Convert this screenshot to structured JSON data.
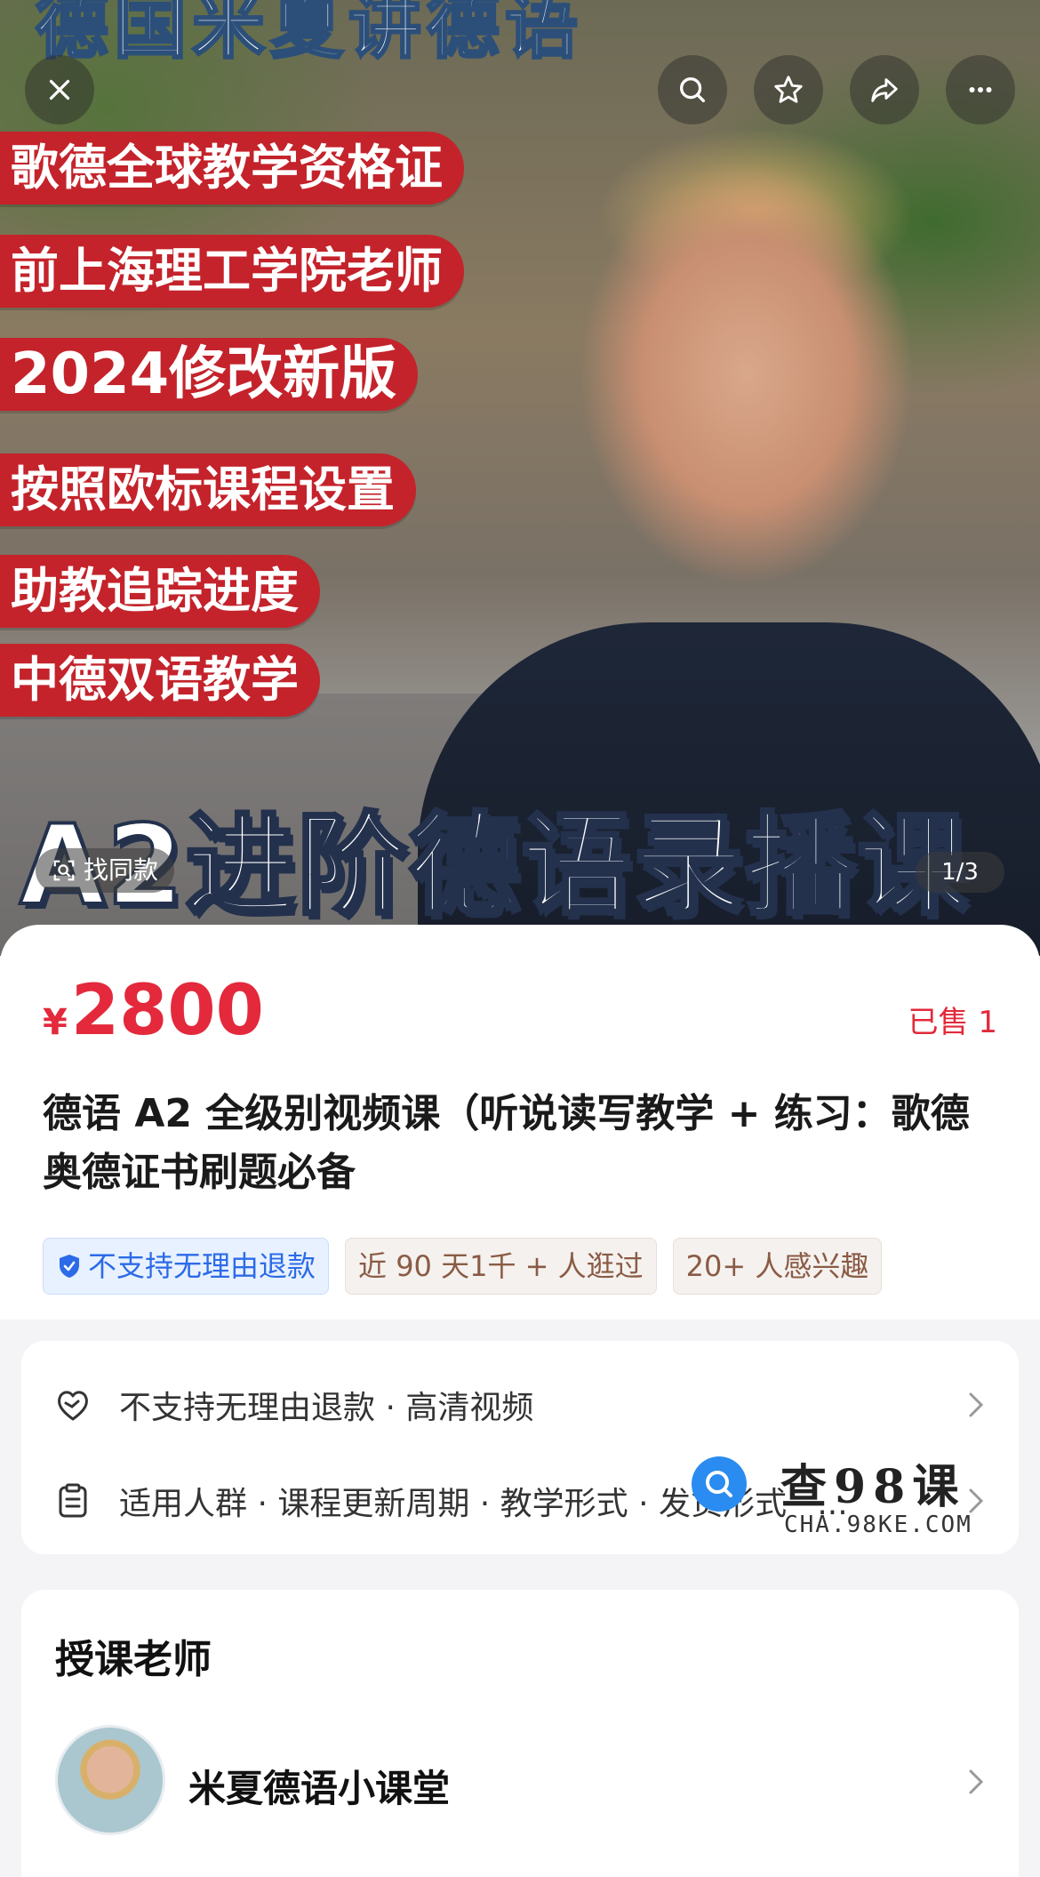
{
  "hero": {
    "top_title": "德国米夏讲德语",
    "tags": [
      "歌德全球教学资格证",
      "前上海理工学院老师",
      "2024修改新版",
      "按照欧标课程设置",
      "助教追踪进度",
      "中德双语教学"
    ],
    "big_title": "A2进阶德语录播课",
    "find_same_label": "找同款",
    "pager": "1/3"
  },
  "toolbar": {
    "icons": [
      "close-icon",
      "search-icon",
      "star-icon",
      "share-icon",
      "more-icon"
    ]
  },
  "product": {
    "currency": "¥",
    "price": "2800",
    "sold": "已售 1",
    "title": "德语 A2 全级别视频课（听说读写教学 + 练习：歌德奥德证书刷题必备",
    "badges": [
      "不支持无理由退款",
      "近 90 天1千 + 人逛过",
      "20+ 人感兴趣"
    ]
  },
  "info": {
    "row1": "不支持无理由退款 · 高清视频",
    "row2": "适用人群 · 课程更新周期 · 教学形式 · 发货形式 · ..."
  },
  "watermark": {
    "text": "查98课",
    "url": "CHA.98KE.COM"
  },
  "teacher": {
    "heading": "授课老师",
    "name": "米夏德语小课堂"
  },
  "colors": {
    "accent": "#e3293b",
    "tag_red": "#c4232b",
    "badge_blue": "#2c6be8"
  }
}
